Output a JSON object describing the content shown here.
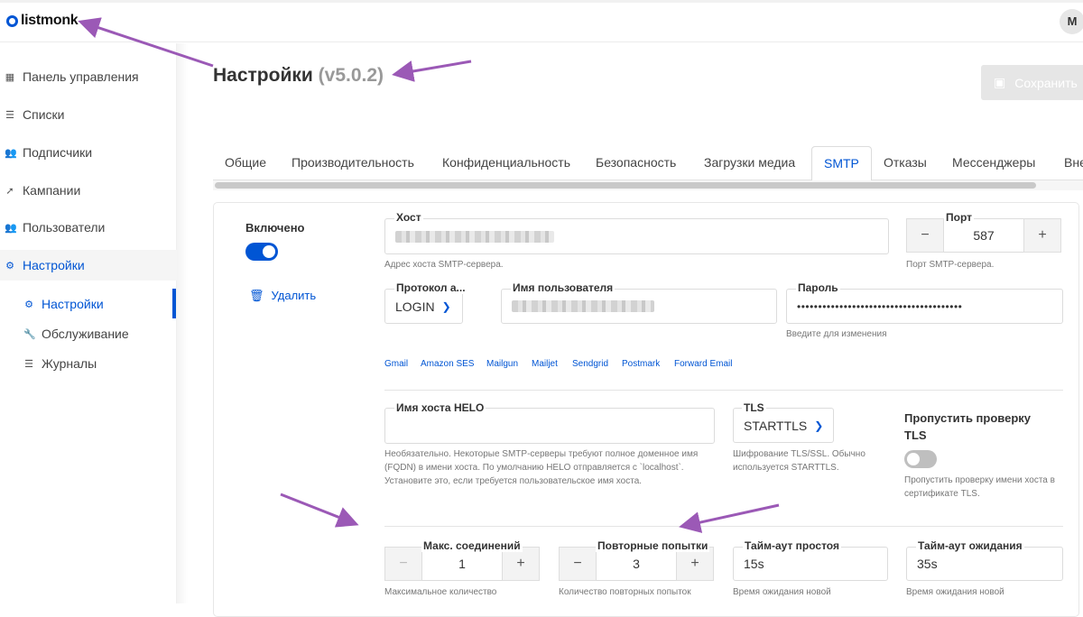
{
  "app": {
    "logo_text": "listmonk",
    "avatar_initial": "M"
  },
  "sidebar": {
    "items": [
      {
        "label": "Панель управления",
        "icon": "dashboard-icon"
      },
      {
        "label": "Списки",
        "icon": "list-icon"
      },
      {
        "label": "Подписчики",
        "icon": "users-icon"
      },
      {
        "label": "Кампании",
        "icon": "rocket-icon"
      },
      {
        "label": "Пользователи",
        "icon": "users-icon"
      },
      {
        "label": "Настройки",
        "icon": "gear-icon"
      }
    ],
    "sub_items": [
      {
        "label": "Настройки",
        "icon": "gear-icon"
      },
      {
        "label": "Обслуживание",
        "icon": "wrench-icon"
      },
      {
        "label": "Журналы",
        "icon": "list-icon"
      }
    ]
  },
  "header": {
    "title": "Настройки",
    "version": "(v5.0.2)",
    "save_label": "Сохранить"
  },
  "tabs": [
    "Общие",
    "Производительность",
    "Конфиденциальность",
    "Безопасность",
    "Загрузки медиа",
    "SMTP",
    "Отказы",
    "Мессенджеры",
    "Вне"
  ],
  "active_tab": "SMTP",
  "smtp": {
    "enabled_label": "Включено",
    "delete_label": "Удалить",
    "host_label": "Хост",
    "host_help": "Адрес хоста SMTP-сервера.",
    "port_label": "Порт",
    "port_value": "587",
    "port_help": "Порт SMTP-сервера.",
    "protocol_label": "Протокол а...",
    "protocol_value": "LOGIN",
    "username_label": "Имя пользователя",
    "password_label": "Пароль",
    "password_value": "•••••••••••••••••••••••••••••••••••••••",
    "password_help": "Введите для изменения",
    "presets": [
      "Gmail",
      "Amazon SES",
      "Mailgun",
      "Mailjet",
      "Sendgrid",
      "Postmark",
      "Forward Email"
    ],
    "helo_label": "Имя хоста HELO",
    "helo_help": "Необязательно. Некоторые SMTP-серверы требуют полное доменное имя (FQDN) в имени хоста. По умолчанию HELO отправляется с `localhost`. Установите это, если требуется пользовательское имя хоста.",
    "tls_label": "TLS",
    "tls_value": "STARTTLS",
    "tls_help": "Шифрование TLS/SSL. Обычно используется STARTTLS.",
    "skip_tls_label": "Пропустить проверку TLS",
    "skip_tls_help": "Пропустить проверку имени хоста в сертификате TLS.",
    "max_conn_label": "Макс. соединений",
    "max_conn_value": "1",
    "max_conn_help": "Максимальное количество",
    "retries_label": "Повторные попытки",
    "retries_value": "3",
    "retries_help": "Количество повторных попыток",
    "idle_label": "Тайм-аут простоя",
    "idle_value": "15s",
    "idle_help": "Время ожидания новой",
    "wait_label": "Тайм-аут ожидания",
    "wait_value": "35s",
    "wait_help": "Время ожидания новой"
  },
  "colors": {
    "accent": "#0055d4",
    "annotation_arrow": "#9b59b6",
    "toggle_on": "#0055d4",
    "toggle_off": "#bfbfbf"
  }
}
